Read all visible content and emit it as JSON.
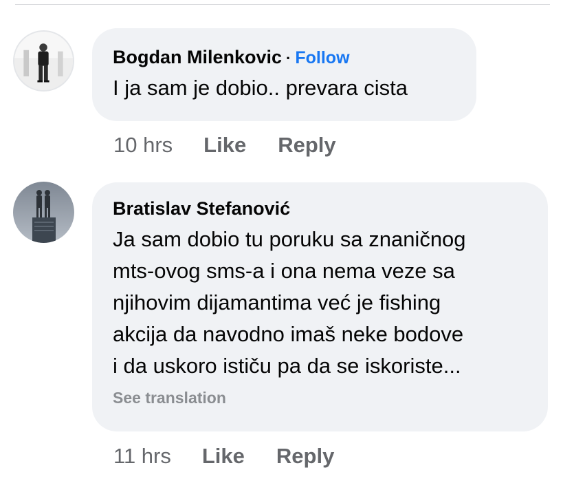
{
  "comments": [
    {
      "author": "Bogdan Milenkovic",
      "separator": "·",
      "follow_label": "Follow",
      "text": "I ja sam je dobio.. prevara cista",
      "time": "10 hrs",
      "like_label": "Like",
      "reply_label": "Reply",
      "avatar_icon": "person-photo-avatar-icon"
    },
    {
      "author": "Bratislav Stefanović",
      "lines": [
        "Ja sam dobio tu poruku sa znaničnog",
        "mts-ovog sms-a i ona nema veze sa",
        "njihovim dijamantima već je fishing",
        "akcija da navodno imaš neke bodove",
        "i da uskoro ističu pa da se iskoriste..."
      ],
      "see_translation": "See translation",
      "time": "11 hrs",
      "like_label": "Like",
      "reply_label": "Reply",
      "avatar_icon": "statue-monument-avatar-icon"
    }
  ],
  "colors": {
    "bubble": "#f0f2f5",
    "link": "#1877f2",
    "meta": "#65676b",
    "translation": "#8a8d91"
  }
}
